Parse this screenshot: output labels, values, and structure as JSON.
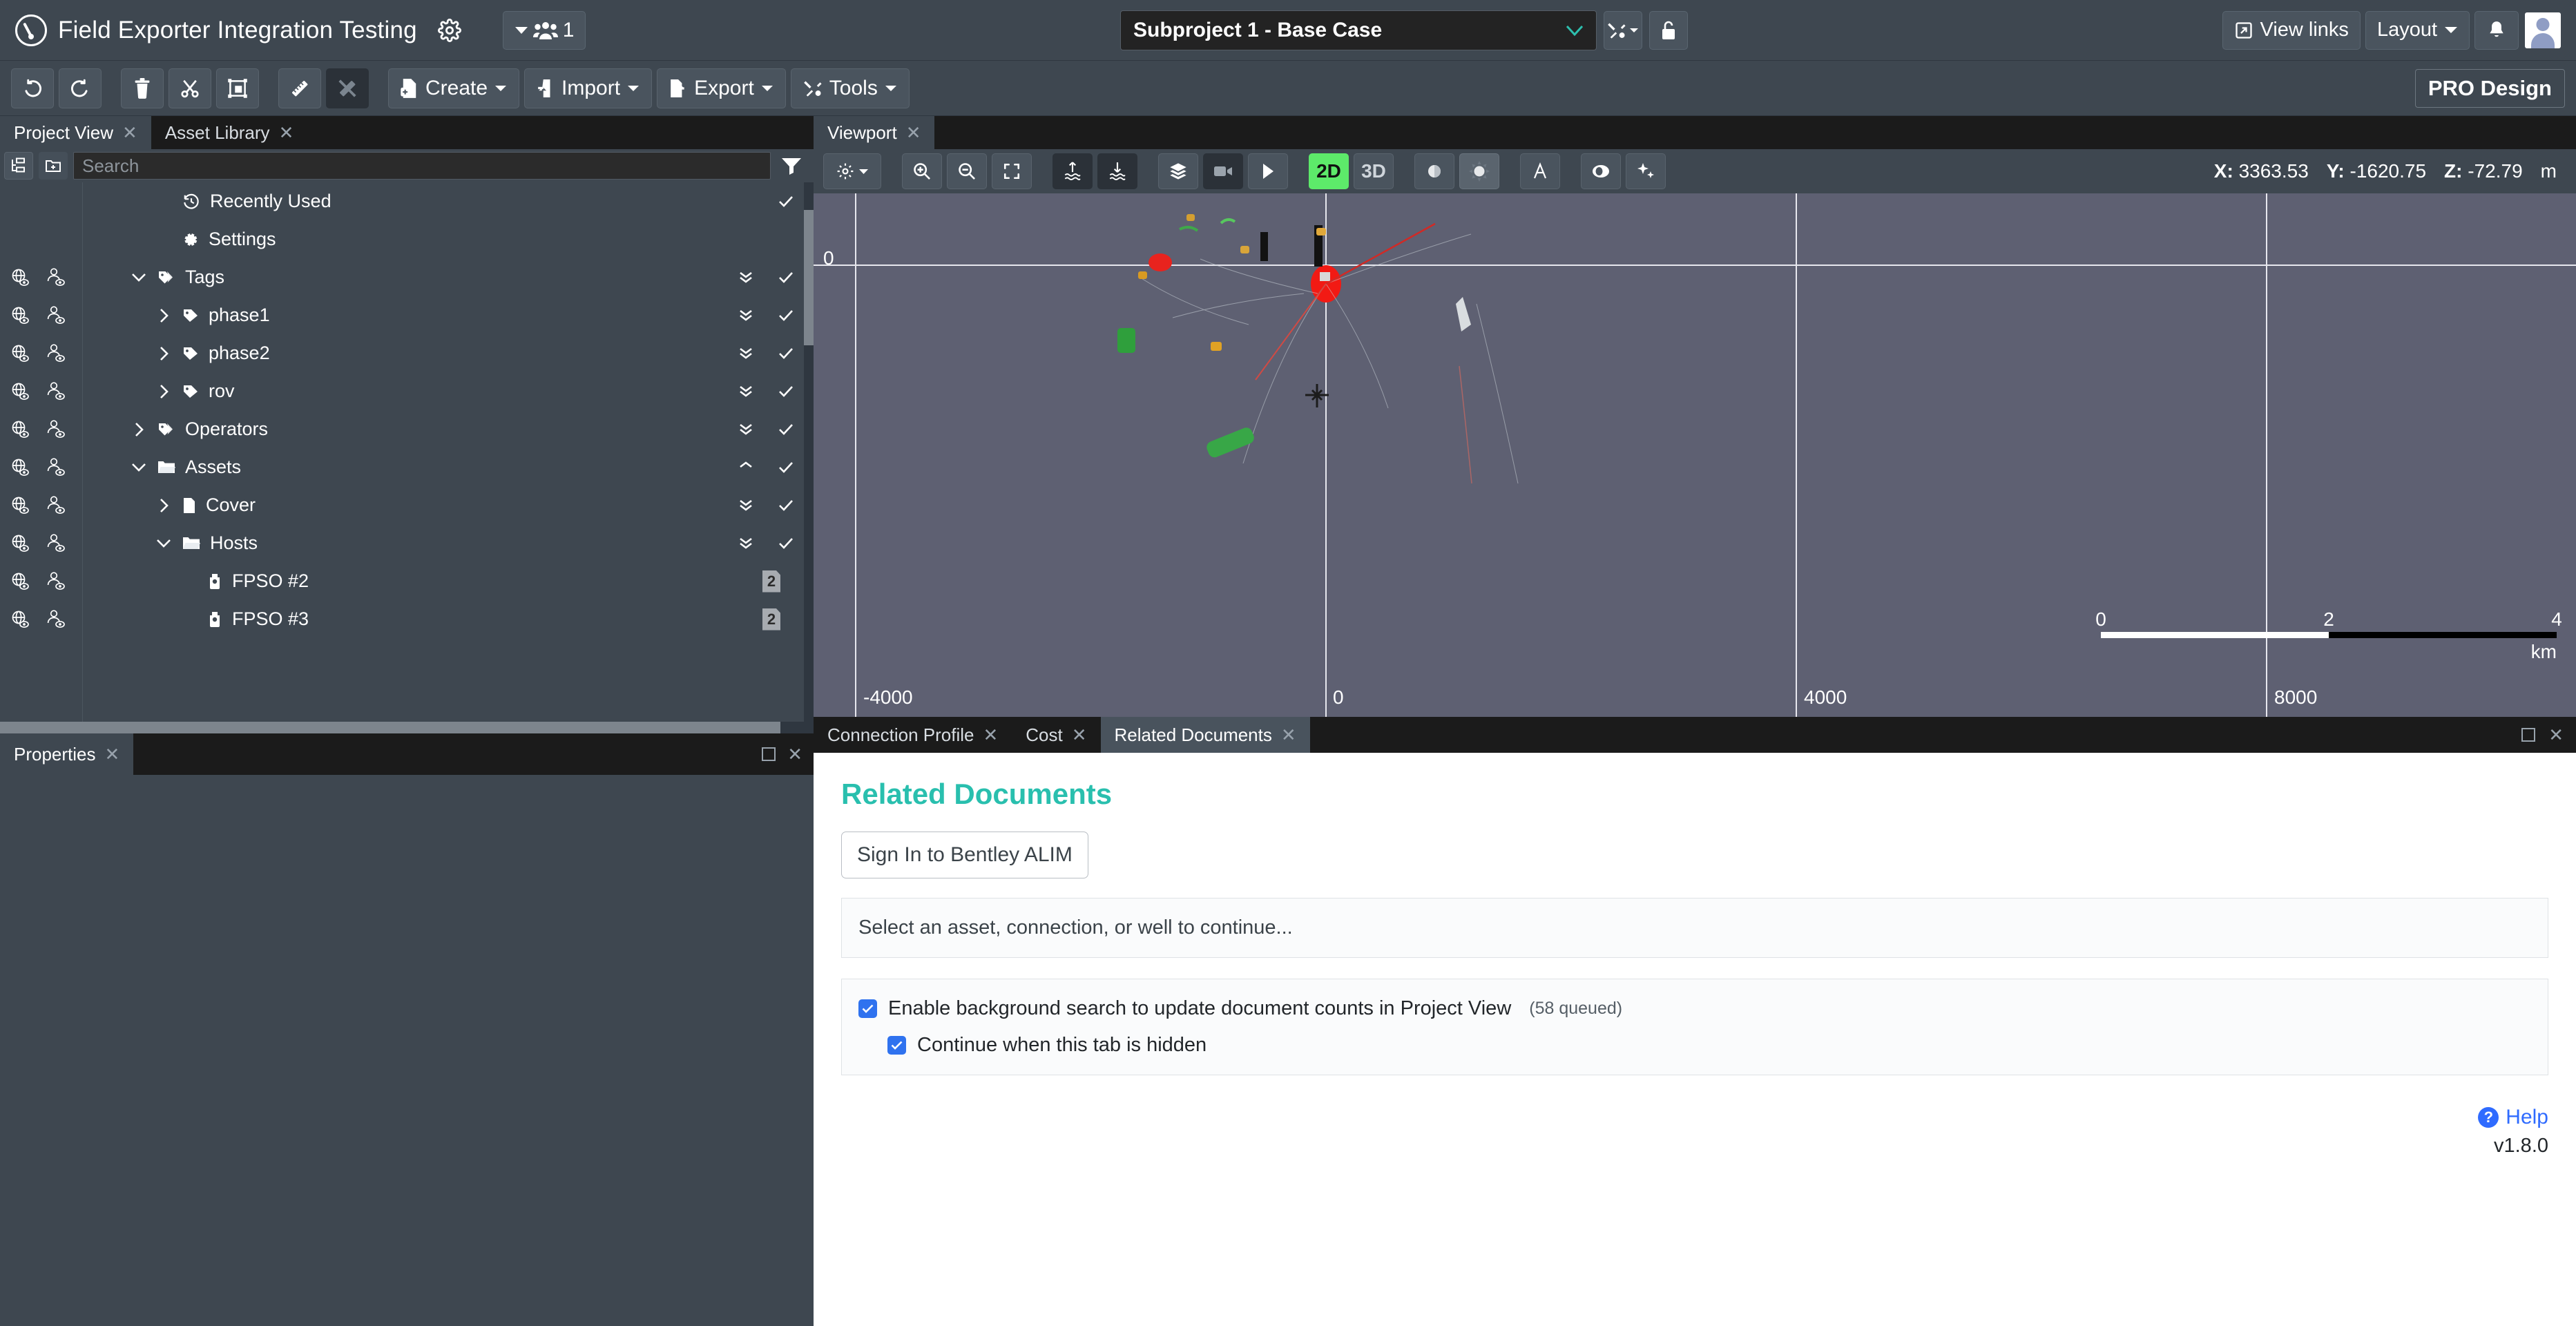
{
  "titlebar": {
    "logo_icon": "compass-logo-icon",
    "app_title": "Field Exporter Integration Testing",
    "settings_icon": "gear-icon",
    "people_count": "1",
    "people_icon": "people-icon",
    "subproject_value": "Subproject 1 - Base Case",
    "subproject_chevron": "chevron-down-icon",
    "tools_icon": "tools-icon",
    "lock_icon": "unlocked-padlock-icon",
    "view_links_label": "View links",
    "view_links_icon": "external-link-icon",
    "layout_label": "Layout",
    "notification_icon": "bell-icon",
    "avatar_icon": "user-avatar"
  },
  "toolbar": {
    "undo_icon": "undo-icon",
    "redo_icon": "redo-icon",
    "delete_icon": "trash-icon",
    "cut_icon": "scissors-icon",
    "frame_icon": "frame-select-icon",
    "measure_icon": "ruler-icon",
    "measure_off_icon": "ruler-crossed-icon",
    "create_label": "Create",
    "import_label": "Import",
    "export_label": "Export",
    "tools_label": "Tools",
    "pro_design_label": "PRO Design"
  },
  "left_panel": {
    "tabs": [
      {
        "label": "Project View",
        "active": true
      },
      {
        "label": "Asset Library",
        "active": false
      }
    ],
    "tree_view_icon": "tree-view-icon",
    "new_folder_icon": "new-folder-icon",
    "search_placeholder": "Search",
    "search_value": "",
    "filter_icon": "filter-icon",
    "tree": [
      {
        "label": "Recently Used",
        "icon": "history-icon",
        "indent": 2,
        "chevron": "none",
        "gutter": false,
        "expand_icon": "",
        "check_icon": "check-icon"
      },
      {
        "label": "Settings",
        "icon": "gear-icon",
        "indent": 2,
        "chevron": "none",
        "gutter": false,
        "expand_icon": "",
        "check_icon": ""
      },
      {
        "label": "Tags",
        "icon": "tags-icon",
        "indent": 1,
        "chevron": "down",
        "gutter": true,
        "expand_icon": "double-chevron-down-icon",
        "check_icon": "check-icon"
      },
      {
        "label": "phase1",
        "icon": "tag-icon",
        "indent": 2,
        "chevron": "right",
        "gutter": true,
        "expand_icon": "double-chevron-down-icon",
        "check_icon": "check-icon"
      },
      {
        "label": "phase2",
        "icon": "tag-icon",
        "indent": 2,
        "chevron": "right",
        "gutter": true,
        "expand_icon": "double-chevron-down-icon",
        "check_icon": "check-icon"
      },
      {
        "label": "rov",
        "icon": "tag-icon",
        "indent": 2,
        "chevron": "right",
        "gutter": true,
        "expand_icon": "double-chevron-down-icon",
        "check_icon": "check-icon"
      },
      {
        "label": "Operators",
        "icon": "tags-icon",
        "indent": 1,
        "chevron": "right",
        "gutter": true,
        "expand_icon": "double-chevron-down-icon",
        "check_icon": "check-icon"
      },
      {
        "label": "Assets",
        "icon": "folder-open-icon",
        "indent": 1,
        "chevron": "down",
        "gutter": true,
        "expand_icon": "double-chevron-up-icon",
        "check_icon": "check-icon"
      },
      {
        "label": "Cover",
        "icon": "file-icon",
        "indent": 2,
        "chevron": "right",
        "gutter": true,
        "expand_icon": "double-chevron-down-icon",
        "check_icon": "check-icon"
      },
      {
        "label": "Hosts",
        "icon": "folder-open-icon",
        "indent": 2,
        "chevron": "down",
        "gutter": true,
        "expand_icon": "double-chevron-down-icon",
        "check_icon": "check-icon"
      },
      {
        "label": "FPSO #2",
        "icon": "host-icon",
        "indent": 3,
        "chevron": "none",
        "gutter": true,
        "expand_icon": "",
        "check_icon": "",
        "badge": "2"
      },
      {
        "label": "FPSO #3",
        "icon": "host-icon",
        "indent": 3,
        "chevron": "none",
        "gutter": true,
        "expand_icon": "",
        "check_icon": "",
        "badge": "2"
      }
    ],
    "gutter_icons": {
      "global_visibility": "globe-eye-icon",
      "user_visibility": "person-eye-icon"
    }
  },
  "properties_panel": {
    "tab_label": "Properties",
    "maximize_icon": "maximize-icon",
    "close_icon": "close-icon"
  },
  "viewport_panel": {
    "tab_label": "Viewport",
    "toolbar": {
      "settings_icon": "gear-dropdown-icon",
      "zoom_in_icon": "zoom-in-icon",
      "zoom_out_icon": "zoom-out-icon",
      "fit_icon": "fit-screen-icon",
      "sea_up_icon": "sea-surface-up-icon",
      "sea_down_icon": "sea-surface-down-icon",
      "layers_icon": "layers-icon",
      "camera_icon": "camera-icon",
      "play_icon": "play-icon",
      "mode_2d_label": "2D",
      "mode_3d_label": "3D",
      "shade_icon": "shading-icon",
      "sun_icon": "sun-shadow-icon",
      "angle_icon": "light-angle-icon",
      "view_icon": "view-icon",
      "effects_icon": "sparkle-icon"
    },
    "coords": {
      "x_label": "X:",
      "x_value": "3363.53",
      "y_label": "Y:",
      "y_value": "-1620.75",
      "z_label": "Z:",
      "z_value": "-72.79",
      "unit": "m"
    },
    "axis_labels": {
      "y_top": "0",
      "x_0": "-4000",
      "x_1": "0",
      "x_2": "4000",
      "x_3": "8000"
    },
    "scalebar": {
      "ticks": [
        "0",
        "2",
        "4"
      ],
      "unit": "km"
    }
  },
  "bottom_panel": {
    "tabs": [
      {
        "label": "Connection Profile",
        "active": false
      },
      {
        "label": "Cost",
        "active": false
      },
      {
        "label": "Related Documents",
        "active": true
      }
    ],
    "maximize_icon": "maximize-icon",
    "close_icon": "close-icon"
  },
  "related_documents": {
    "title": "Related Documents",
    "signin_label": "Sign In to Bentley ALIM",
    "notice": "Select an asset, connection, or well to continue...",
    "option_main": {
      "label": "Enable background search to update document counts in Project View",
      "queued": "(58 queued)",
      "checked": true
    },
    "option_sub": {
      "label": "Continue when this tab is hidden",
      "checked": true
    },
    "help_label": "Help",
    "help_icon": "question-circle-icon",
    "version": "v1.8.0"
  },
  "colors": {
    "chrome": "#3e4750",
    "accent_teal": "#29bfae",
    "active_green": "#5dea6a",
    "checkbox_blue": "#2f72ef",
    "link_blue": "#2f6bff",
    "viewport_bg": "#5e6072"
  }
}
